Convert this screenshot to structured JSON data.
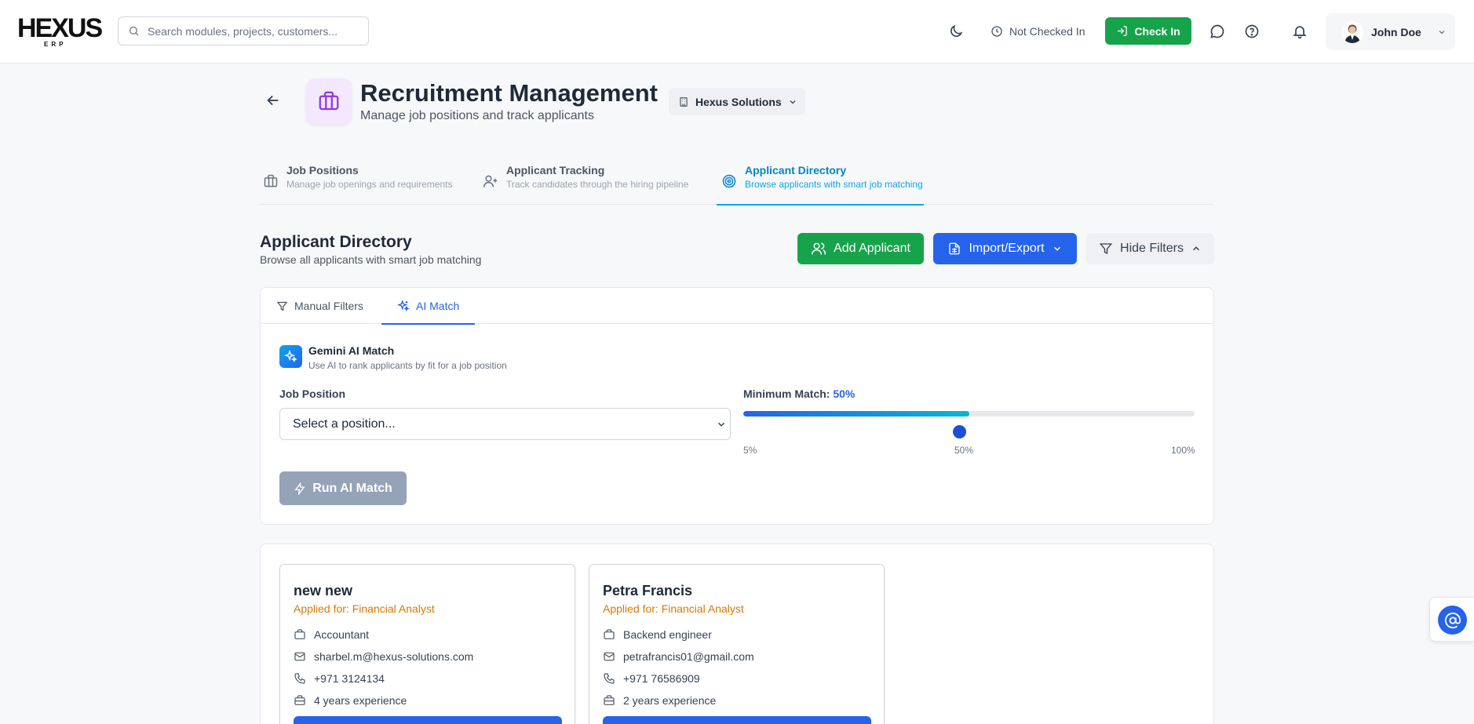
{
  "header": {
    "logo_main": "HEXUS",
    "logo_sub": "ERP",
    "search_placeholder": "Search modules, projects, customers...",
    "check_status": "Not Checked In",
    "check_in_label": "Check In",
    "user_name": "John Doe"
  },
  "page": {
    "title": "Recruitment Management",
    "subtitle": "Manage job positions and track applicants",
    "company": "Hexus Solutions"
  },
  "module_tabs": [
    {
      "title": "Job Positions",
      "subtitle": "Manage job openings and requirements"
    },
    {
      "title": "Applicant Tracking",
      "subtitle": "Track candidates through the hiring pipeline"
    },
    {
      "title": "Applicant Directory",
      "subtitle": "Browse applicants with smart job matching"
    }
  ],
  "section": {
    "title": "Applicant Directory",
    "subtitle": "Browse all applicants with smart job matching",
    "add_label": "Add Applicant",
    "import_label": "Import/Export",
    "hide_label": "Hide Filters"
  },
  "filters": {
    "tab_manual": "Manual Filters",
    "tab_ai": "AI Match",
    "gemini_title": "Gemini AI Match",
    "gemini_sub": "Use AI to rank applicants by fit for a job position",
    "job_label": "Job Position",
    "job_value": "Select a position...",
    "min_label": "Minimum Match:",
    "min_value": "50%",
    "min_fraction": 0.5,
    "tick_min": "5%",
    "tick_mid": "50%",
    "tick_max": "100%",
    "run_label": "Run AI Match"
  },
  "applicants": [
    {
      "name": "new new",
      "applied": "Applied for: Financial Analyst",
      "role": "Accountant",
      "email": "sharbel.m@hexus-solutions.com",
      "phone": "+971 3124134",
      "experience": "4 years experience"
    },
    {
      "name": "Petra Francis",
      "applied": "Applied for: Financial Analyst",
      "role": "Backend engineer",
      "email": "petrafrancis01@gmail.com",
      "phone": "+971 76586909",
      "experience": "2 years experience"
    }
  ],
  "colors": {
    "accent_blue": "#2563eb",
    "accent_green": "#16a34a",
    "tab_active": "#0ea5e9",
    "applied_orange": "#d97706",
    "page_icon_bg": "#f3e8ff"
  }
}
